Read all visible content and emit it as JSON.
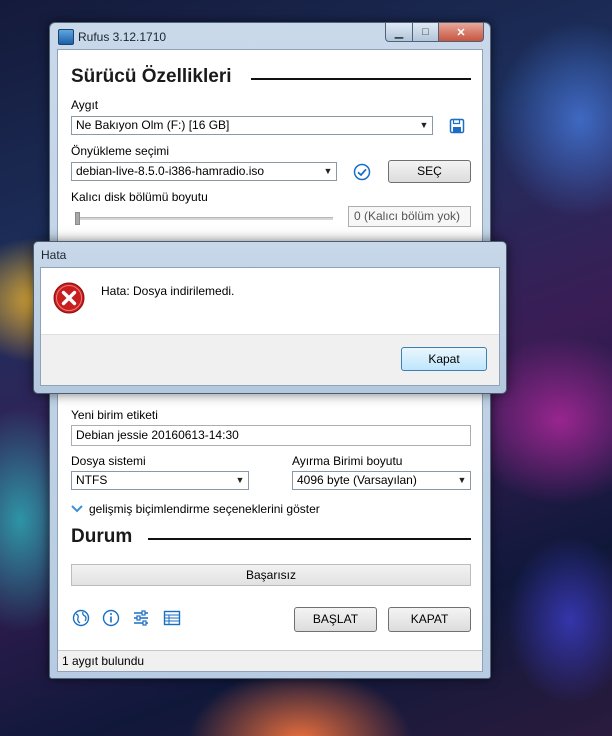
{
  "window": {
    "title": "Rufus 3.12.1710"
  },
  "drive_props": {
    "heading": "Sürücü Özellikleri",
    "device_label": "Aygıt",
    "device_value": "Ne Bakıyon Olm (F:) [16 GB]",
    "boot_label": "Önyükleme seçimi",
    "boot_value": "debian-live-8.5.0-i386-hamradio.iso",
    "select_button": "SEÇ",
    "persistent_label": "Kalıcı disk bölümü boyutu",
    "persistent_value": "0 (Kalıcı bölüm yok)",
    "persistent_level": 0
  },
  "format": {
    "volume_label_label": "Yeni birim etiketi",
    "volume_label_value": "Debian jessie 20160613-14:30",
    "fs_label": "Dosya sistemi",
    "fs_value": "NTFS",
    "cluster_label": "Ayırma Birimi boyutu",
    "cluster_value": "4096 byte (Varsayılan)",
    "advanced_toggle": "gelişmiş biçimlendirme seçeneklerini göster"
  },
  "status": {
    "heading": "Durum",
    "progress_text": "Başarısız",
    "start_button": "BAŞLAT",
    "close_button": "KAPAT",
    "statusbar_text": "1 aygıt bulundu"
  },
  "dialog": {
    "title": "Hata",
    "message": "Hata: Dosya indirilemedi.",
    "ok_button": "Kapat"
  },
  "colors": {
    "accent_icon": "#1a6fc4",
    "error_red": "#c81e1e"
  }
}
